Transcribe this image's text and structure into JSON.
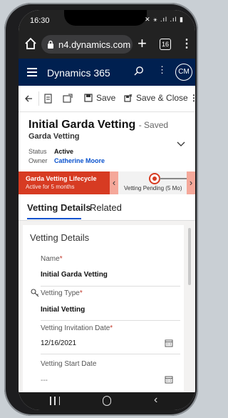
{
  "status_bar": {
    "time": "16:30",
    "indicators": "✕ ⚹ .ıl .ıl ▮"
  },
  "browser": {
    "url": "n4.dynamics.com",
    "tab_count": "16",
    "plus": "+",
    "more": "⋮"
  },
  "app": {
    "title": "Dynamics 365",
    "more": "⋮",
    "avatar": "CM"
  },
  "commands": {
    "save": "Save",
    "save_close": "Save & Close",
    "overflow": "⋮"
  },
  "record": {
    "title": "Initial Garda Vetting",
    "saved": "- Saved",
    "entity": "Garda Vetting",
    "status_label": "Status",
    "status_value": "Active",
    "owner_label": "Owner",
    "owner_value": "Catherine Moore"
  },
  "bpf": {
    "name": "Garda Vetting Lifecycle",
    "duration": "Active for 5 months",
    "stage": "Vetting Pending  (5 Mo)",
    "prev": "‹",
    "next": "›"
  },
  "tabs": [
    {
      "label": "Vetting Details"
    },
    {
      "label": "Related"
    }
  ],
  "section": {
    "title": "Vetting Details",
    "fields": [
      {
        "label": "Name",
        "required": "*",
        "value": "Initial Garda Vetting"
      },
      {
        "label": "Vetting Type",
        "required": "*",
        "value": "Initial Vetting"
      },
      {
        "label": "Vetting Invitation Date",
        "required": "*",
        "value": "12/16/2021"
      },
      {
        "label": "Vetting Start Date",
        "required": "",
        "value": "---"
      }
    ]
  },
  "colors": {
    "app_header": "#002050",
    "bpf_active": "#d73b22",
    "link": "#0b53ce"
  }
}
